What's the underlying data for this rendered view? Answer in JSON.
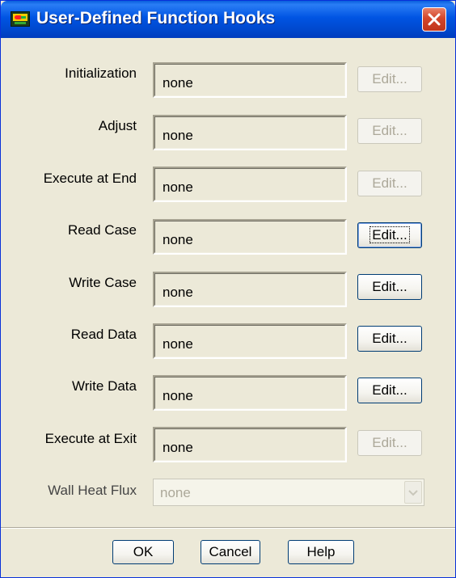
{
  "window": {
    "title": "User-Defined Function Hooks",
    "icon": "fluent-app-icon",
    "close_icon": "close-icon"
  },
  "hooks": [
    {
      "label": "Initialization",
      "value": "none",
      "edit_label": "Edit...",
      "edit_enabled": false
    },
    {
      "label": "Adjust",
      "value": "none",
      "edit_label": "Edit...",
      "edit_enabled": false
    },
    {
      "label": "Execute at End",
      "value": "none",
      "edit_label": "Edit...",
      "edit_enabled": false
    },
    {
      "label": "Read Case",
      "value": "none",
      "edit_label": "Edit...",
      "edit_enabled": true,
      "focused": true
    },
    {
      "label": "Write Case",
      "value": "none",
      "edit_label": "Edit...",
      "edit_enabled": true
    },
    {
      "label": "Read Data",
      "value": "none",
      "edit_label": "Edit...",
      "edit_enabled": true
    },
    {
      "label": "Write Data",
      "value": "none",
      "edit_label": "Edit...",
      "edit_enabled": true
    },
    {
      "label": "Execute at Exit",
      "value": "none",
      "edit_label": "Edit...",
      "edit_enabled": false
    }
  ],
  "wall_heat_flux": {
    "label": "Wall Heat Flux",
    "value": "none",
    "enabled": false
  },
  "buttons": {
    "ok": "OK",
    "cancel": "Cancel",
    "help": "Help"
  },
  "colors": {
    "titlebar": "#0054e3",
    "dialog_bg": "#ece9d8",
    "close_button": "#d3462b",
    "button_border": "#003c74",
    "disabled_text": "#aca899"
  }
}
